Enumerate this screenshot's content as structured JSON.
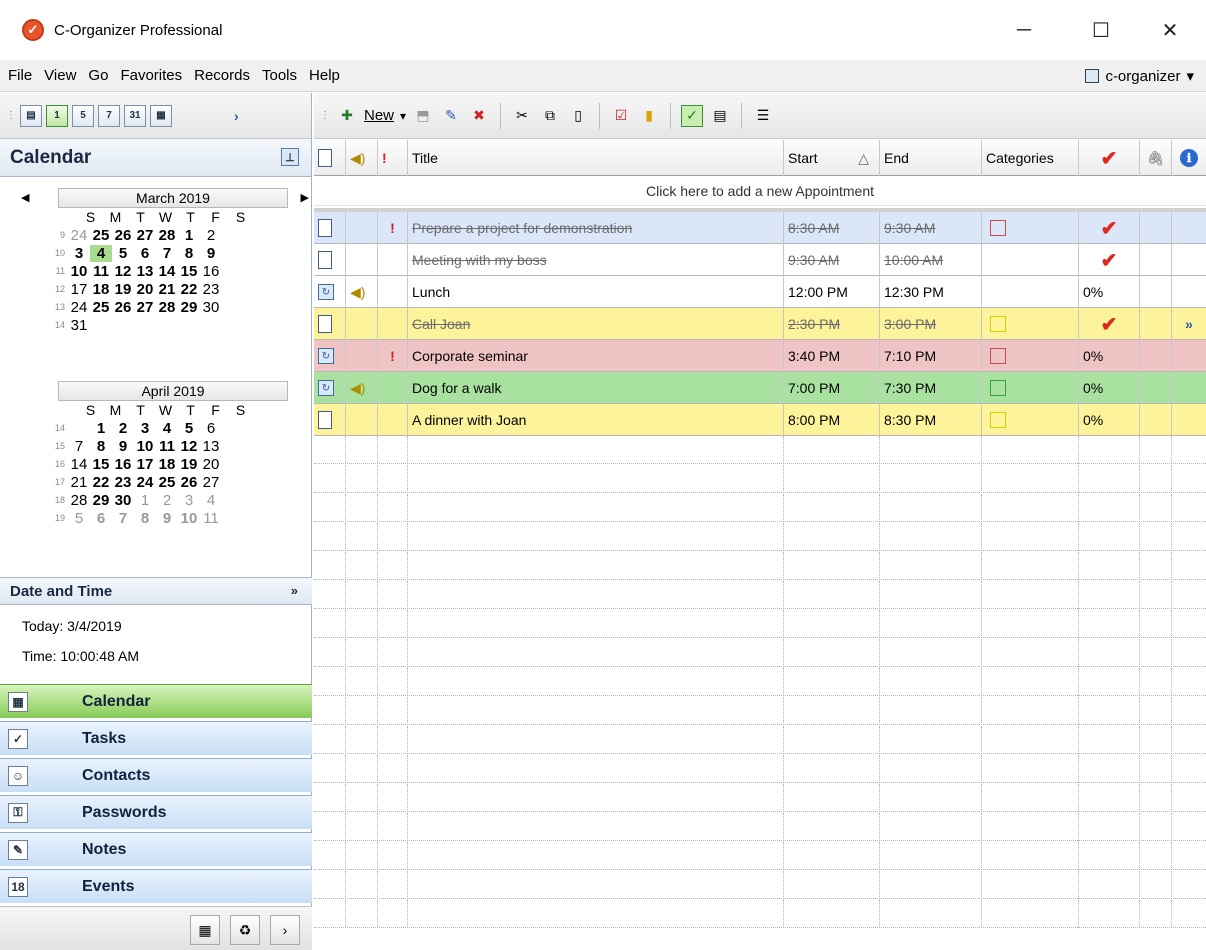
{
  "window": {
    "title": "C-Organizer Professional",
    "minimize": "─",
    "maximize": "☐",
    "close": "✕"
  },
  "menu": [
    "File",
    "View",
    "Go",
    "Favorites",
    "Records",
    "Tools",
    "Help"
  ],
  "account": {
    "label": "c-organizer",
    "arrow": "▾"
  },
  "left_toolbar": [
    "▤",
    "▥",
    "1",
    "5",
    "7",
    "31",
    "▦",
    "›"
  ],
  "calendar_panel": {
    "title": "Calendar"
  },
  "march": {
    "title": "March 2019",
    "prev": "◀",
    "next": "▶",
    "dow": [
      "S",
      "M",
      "T",
      "W",
      "T",
      "F",
      "S"
    ],
    "weeks": [
      {
        "n": "9",
        "days": [
          "24",
          "25",
          "26",
          "27",
          "28",
          "1",
          "2"
        ],
        "bold": [
          0,
          1,
          1,
          1,
          1,
          1,
          0
        ],
        "grey": [
          1,
          0,
          0,
          0,
          0,
          0,
          0
        ]
      },
      {
        "n": "10",
        "days": [
          "3",
          "4",
          "5",
          "6",
          "7",
          "8",
          "9"
        ],
        "bold": [
          1,
          1,
          1,
          1,
          1,
          1,
          1
        ],
        "grey": [
          0,
          0,
          0,
          0,
          0,
          0,
          0
        ]
      },
      {
        "n": "11",
        "days": [
          "10",
          "11",
          "12",
          "13",
          "14",
          "15",
          "16"
        ],
        "bold": [
          1,
          1,
          1,
          1,
          1,
          1,
          0
        ],
        "grey": [
          0,
          0,
          0,
          0,
          0,
          0,
          0
        ]
      },
      {
        "n": "12",
        "days": [
          "17",
          "18",
          "19",
          "20",
          "21",
          "22",
          "23"
        ],
        "bold": [
          0,
          1,
          1,
          1,
          1,
          1,
          0
        ],
        "grey": [
          0,
          0,
          0,
          0,
          0,
          0,
          0
        ]
      },
      {
        "n": "13",
        "days": [
          "24",
          "25",
          "26",
          "27",
          "28",
          "29",
          "30"
        ],
        "bold": [
          0,
          1,
          1,
          1,
          1,
          1,
          0
        ],
        "grey": [
          0,
          0,
          0,
          0,
          0,
          0,
          0
        ]
      },
      {
        "n": "14",
        "days": [
          "31",
          "",
          "",
          "",
          "",
          "",
          ""
        ],
        "bold": [
          0,
          0,
          0,
          0,
          0,
          0,
          0
        ],
        "grey": [
          0,
          0,
          0,
          0,
          0,
          0,
          0
        ]
      }
    ]
  },
  "april": {
    "title": "April 2019",
    "dow": [
      "S",
      "M",
      "T",
      "W",
      "T",
      "F",
      "S"
    ],
    "weeks": [
      {
        "n": "14",
        "days": [
          "",
          "1",
          "2",
          "3",
          "4",
          "5",
          "6"
        ],
        "bold": [
          0,
          1,
          1,
          1,
          1,
          1,
          0
        ],
        "grey": [
          0,
          0,
          0,
          0,
          0,
          0,
          0
        ]
      },
      {
        "n": "15",
        "days": [
          "7",
          "8",
          "9",
          "10",
          "11",
          "12",
          "13"
        ],
        "bold": [
          0,
          1,
          1,
          1,
          1,
          1,
          0
        ],
        "grey": [
          0,
          0,
          0,
          0,
          0,
          0,
          0
        ]
      },
      {
        "n": "16",
        "days": [
          "14",
          "15",
          "16",
          "17",
          "18",
          "19",
          "20"
        ],
        "bold": [
          0,
          1,
          1,
          1,
          1,
          1,
          0
        ],
        "grey": [
          0,
          0,
          0,
          0,
          0,
          0,
          0
        ]
      },
      {
        "n": "17",
        "days": [
          "21",
          "22",
          "23",
          "24",
          "25",
          "26",
          "27"
        ],
        "bold": [
          0,
          1,
          1,
          1,
          1,
          1,
          0
        ],
        "grey": [
          0,
          0,
          0,
          0,
          0,
          0,
          0
        ]
      },
      {
        "n": "18",
        "days": [
          "28",
          "29",
          "30",
          "1",
          "2",
          "3",
          "4"
        ],
        "bold": [
          0,
          1,
          1,
          0,
          0,
          0,
          0
        ],
        "grey": [
          0,
          0,
          0,
          1,
          1,
          1,
          1
        ]
      },
      {
        "n": "19",
        "days": [
          "5",
          "6",
          "7",
          "8",
          "9",
          "10",
          "11"
        ],
        "bold": [
          0,
          1,
          1,
          1,
          1,
          1,
          0
        ],
        "grey": [
          1,
          1,
          1,
          1,
          1,
          1,
          1
        ]
      }
    ]
  },
  "datetime": {
    "title": "Date and Time",
    "expand": "»",
    "today": "Today: 3/4/2019",
    "time": "Time: 10:00:48 AM"
  },
  "nav": [
    {
      "label": "Calendar",
      "icon": "▦",
      "active": true
    },
    {
      "label": "Tasks",
      "icon": "✓",
      "active": false
    },
    {
      "label": "Contacts",
      "icon": "☺",
      "active": false
    },
    {
      "label": "Passwords",
      "icon": "⚿",
      "active": false
    },
    {
      "label": "Notes",
      "icon": "✎",
      "active": false
    },
    {
      "label": "Events",
      "icon": "18",
      "active": false
    }
  ],
  "left_bottom": [
    "▦",
    "♻",
    "›"
  ],
  "right_toolbar": {
    "new_label": "New",
    "new_arrow": "▾",
    "icons": [
      "✚",
      "✎",
      "✖",
      "✂",
      "⧉",
      "📋",
      "☑",
      "✓",
      "▤",
      "☰"
    ]
  },
  "columns": {
    "title": "Title",
    "start": "Start",
    "sort": "△",
    "end": "End",
    "categories": "Categories",
    "check": "✔",
    "attach": "🖇",
    "info": "ℹ"
  },
  "add_row": "Click here to add a new Appointment",
  "rows": [
    {
      "icon": "doc",
      "sound": false,
      "important": true,
      "title": "Prepare a project for demonstration",
      "start": "8:30 AM",
      "end": "9:30 AM",
      "cat": "#d04848",
      "done": true,
      "pct": "",
      "bg": "#dbe7f8",
      "strike": true
    },
    {
      "icon": "doc",
      "sound": false,
      "important": false,
      "title": "Meeting with my boss",
      "start": "9:30 AM",
      "end": "10:00 AM",
      "cat": "",
      "done": true,
      "pct": "",
      "bg": "#ffffff",
      "strike": true
    },
    {
      "icon": "rec",
      "sound": true,
      "important": false,
      "title": "Lunch",
      "start": "12:00 PM",
      "end": "12:30 PM",
      "cat": "",
      "done": false,
      "pct": "0%",
      "bg": "#ffffff",
      "strike": false
    },
    {
      "icon": "doc",
      "sound": false,
      "important": false,
      "title": "Call Joan",
      "start": "2:30 PM",
      "end": "3:00 PM",
      "cat": "#e0c800",
      "done": true,
      "pct": "",
      "bg": "#fdf39a",
      "strike": true,
      "extra": "»"
    },
    {
      "icon": "rec",
      "sound": false,
      "important": true,
      "title": "Corporate seminar",
      "start": "3:40 PM",
      "end": "7:10 PM",
      "cat": "#c74c4c",
      "done": false,
      "pct": "0%",
      "bg": "#efc4c4",
      "strike": false
    },
    {
      "icon": "rec",
      "sound": true,
      "important": false,
      "title": "Dog for a walk",
      "start": "7:00 PM",
      "end": "7:30 PM",
      "cat": "#3e9f3e",
      "done": false,
      "pct": "0%",
      "bg": "#a9e2a0",
      "strike": false
    },
    {
      "icon": "doc",
      "sound": false,
      "important": false,
      "title": "A dinner with Joan",
      "start": "8:00 PM",
      "end": "8:30 PM",
      "cat": "#e0c800",
      "done": false,
      "pct": "0%",
      "bg": "#fdf39a",
      "strike": false
    }
  ],
  "icons": {
    "doc": "document-icon",
    "rec": "recurrence-icon",
    "sound": "sound-icon",
    "important": "important-icon",
    "done": "done-check-icon"
  }
}
